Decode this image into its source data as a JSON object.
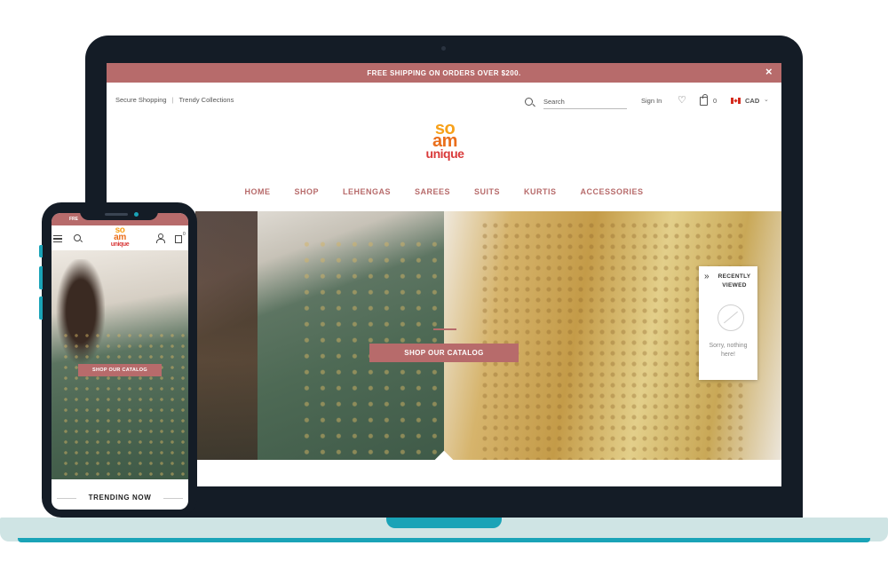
{
  "desktop": {
    "promo": {
      "text": "FREE SHIPPING ON ORDERS OVER $200.",
      "close": "×"
    },
    "utility": {
      "left": "Secure Shopping",
      "separator": "|",
      "right": "Trendy Collections"
    },
    "header": {
      "search_placeholder": "Search",
      "sign_in": "Sign In",
      "cart_count": "0",
      "currency": "CAD",
      "currency_chevron": "⌄"
    },
    "logo": {
      "line1": "so",
      "line2": "am",
      "line3": "unique"
    },
    "nav": [
      "HOME",
      "SHOP",
      "LEHENGAS",
      "SAREES",
      "SUITS",
      "KURTIS",
      "ACCESSORIES"
    ],
    "hero": {
      "cta": "SHOP OUR CATALOG"
    },
    "recently_viewed": {
      "chevron": "»",
      "title": "RECENTLY VIEWED",
      "empty": "Sorry, nothing here!"
    }
  },
  "mobile": {
    "promo": "FRE",
    "cart_count": "0",
    "logo": {
      "line1": "so",
      "line2": "am",
      "line3": "unique"
    },
    "hero": {
      "cta": "SHOP OUR CATALOG"
    },
    "trending": "TRENDING NOW"
  },
  "colors": {
    "accent": "#b76b6b",
    "device_frame": "#141c26",
    "device_accent": "#1aa3b7",
    "logo_yellow": "#f7a11a",
    "logo_orange": "#ea6f1c",
    "logo_red": "#d93a3a"
  },
  "icons": [
    "search-icon",
    "heart-icon",
    "bag-icon",
    "flag-ca-icon",
    "close-icon",
    "chevron-down-icon",
    "double-chevron-icon",
    "no-image-icon",
    "menu-icon",
    "user-icon"
  ]
}
